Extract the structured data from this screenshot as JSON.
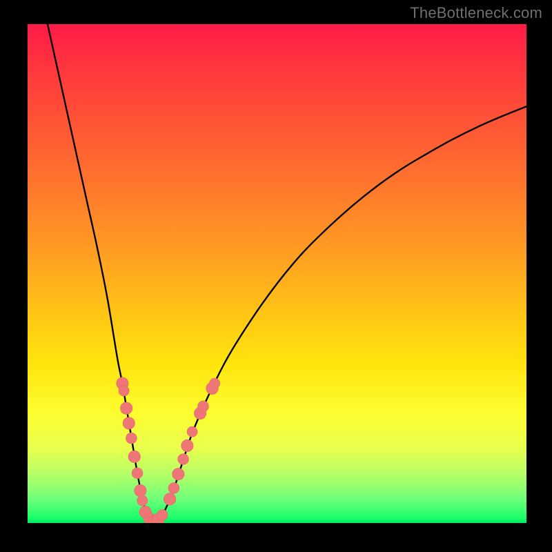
{
  "watermark": "TheBottleneck.com",
  "colors": {
    "frame": "#000000",
    "curve_stroke": "#000000",
    "marker_fill": "#ef7676",
    "marker_stroke": "#e86868"
  },
  "chart_data": {
    "type": "line",
    "title": "",
    "xlabel": "",
    "ylabel": "",
    "xlim": [
      0,
      100
    ],
    "ylim": [
      0,
      100
    ],
    "x_at_min": 25,
    "series": [
      {
        "name": "bottleneck-curve",
        "x": [
          4,
          6,
          8,
          10,
          12,
          14,
          16,
          18,
          19,
          20,
          21,
          22,
          23,
          24,
          25,
          26,
          27,
          29,
          31,
          33,
          36,
          40,
          45,
          50,
          55,
          60,
          65,
          70,
          75,
          80,
          85,
          90,
          95,
          100
        ],
        "y": [
          100,
          91,
          82,
          73,
          64,
          55,
          45,
          33,
          28,
          22,
          16,
          10,
          5,
          1.5,
          0.3,
          0.3,
          1.5,
          6,
          12,
          18,
          25,
          33,
          41,
          48,
          54,
          59,
          63.5,
          67.5,
          71,
          74,
          76.8,
          79.3,
          81.5,
          83.5
        ]
      }
    ],
    "markers": {
      "name": "highlight-dots",
      "points": [
        {
          "x": 19.0,
          "y": 28.0,
          "r": 2.2
        },
        {
          "x": 19.3,
          "y": 26.5,
          "r": 1.9
        },
        {
          "x": 19.8,
          "y": 23.0,
          "r": 2.2
        },
        {
          "x": 20.3,
          "y": 20.0,
          "r": 2.2
        },
        {
          "x": 20.8,
          "y": 17.0,
          "r": 2.0
        },
        {
          "x": 21.4,
          "y": 13.3,
          "r": 2.2
        },
        {
          "x": 22.0,
          "y": 10.0,
          "r": 2.0
        },
        {
          "x": 22.6,
          "y": 6.5,
          "r": 2.2
        },
        {
          "x": 23.0,
          "y": 4.5,
          "r": 1.9
        },
        {
          "x": 23.6,
          "y": 2.2,
          "r": 2.2
        },
        {
          "x": 24.4,
          "y": 0.9,
          "r": 2.2
        },
        {
          "x": 25.3,
          "y": 0.3,
          "r": 2.2
        },
        {
          "x": 26.2,
          "y": 0.7,
          "r": 2.2
        },
        {
          "x": 27.0,
          "y": 1.6,
          "r": 2.0
        },
        {
          "x": 28.5,
          "y": 4.8,
          "r": 2.2
        },
        {
          "x": 29.3,
          "y": 7.0,
          "r": 2.0
        },
        {
          "x": 30.2,
          "y": 9.8,
          "r": 2.2
        },
        {
          "x": 31.2,
          "y": 12.8,
          "r": 2.0
        },
        {
          "x": 32.0,
          "y": 15.5,
          "r": 2.2
        },
        {
          "x": 33.0,
          "y": 18.3,
          "r": 1.9
        },
        {
          "x": 34.6,
          "y": 22.0,
          "r": 2.2
        },
        {
          "x": 35.2,
          "y": 23.4,
          "r": 2.0
        },
        {
          "x": 37.0,
          "y": 27.0,
          "r": 2.2
        },
        {
          "x": 37.5,
          "y": 28.0,
          "r": 1.9
        }
      ]
    }
  }
}
